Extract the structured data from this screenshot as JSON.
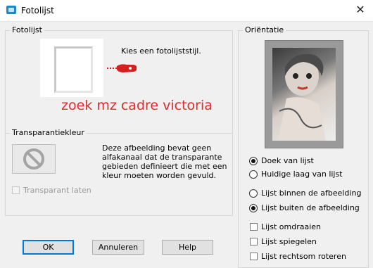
{
  "window": {
    "title": "Fotolijst",
    "close_glyph": "✕"
  },
  "fotolijst": {
    "legend": "Fotolijst",
    "instruction": "Kies een fotolijststijl.",
    "annotation": "zoek mz cadre victoria",
    "annotation_color": "#e02b2b"
  },
  "transparantie": {
    "legend": "Transparantiekleur",
    "info": "Deze afbeelding bevat geen alfakanaal dat de transparante gebieden definieert die met een kleur moeten worden gevuld.",
    "checkbox_label": "Transparant laten",
    "checkbox_checked": false,
    "checkbox_enabled": false
  },
  "orientatie": {
    "legend": "Oriëntatie",
    "group1": [
      {
        "label": "Doek van lijst",
        "checked": true
      },
      {
        "label": "Huidige laag van lijst",
        "checked": false
      }
    ],
    "group2": [
      {
        "label": "Lijst binnen de afbeelding",
        "checked": false
      },
      {
        "label": "Lijst buiten de afbeelding",
        "checked": true
      }
    ],
    "checkboxes": [
      {
        "label": "Lijst omdraaien",
        "checked": false
      },
      {
        "label": "Lijst spiegelen",
        "checked": false
      },
      {
        "label": "Lijst rechtsom roteren",
        "checked": false
      }
    ]
  },
  "buttons": {
    "ok": "OK",
    "cancel": "Annuleren",
    "help": "Help"
  },
  "colors": {
    "accent": "#0078d7",
    "app_icon": "#1e88c7"
  }
}
